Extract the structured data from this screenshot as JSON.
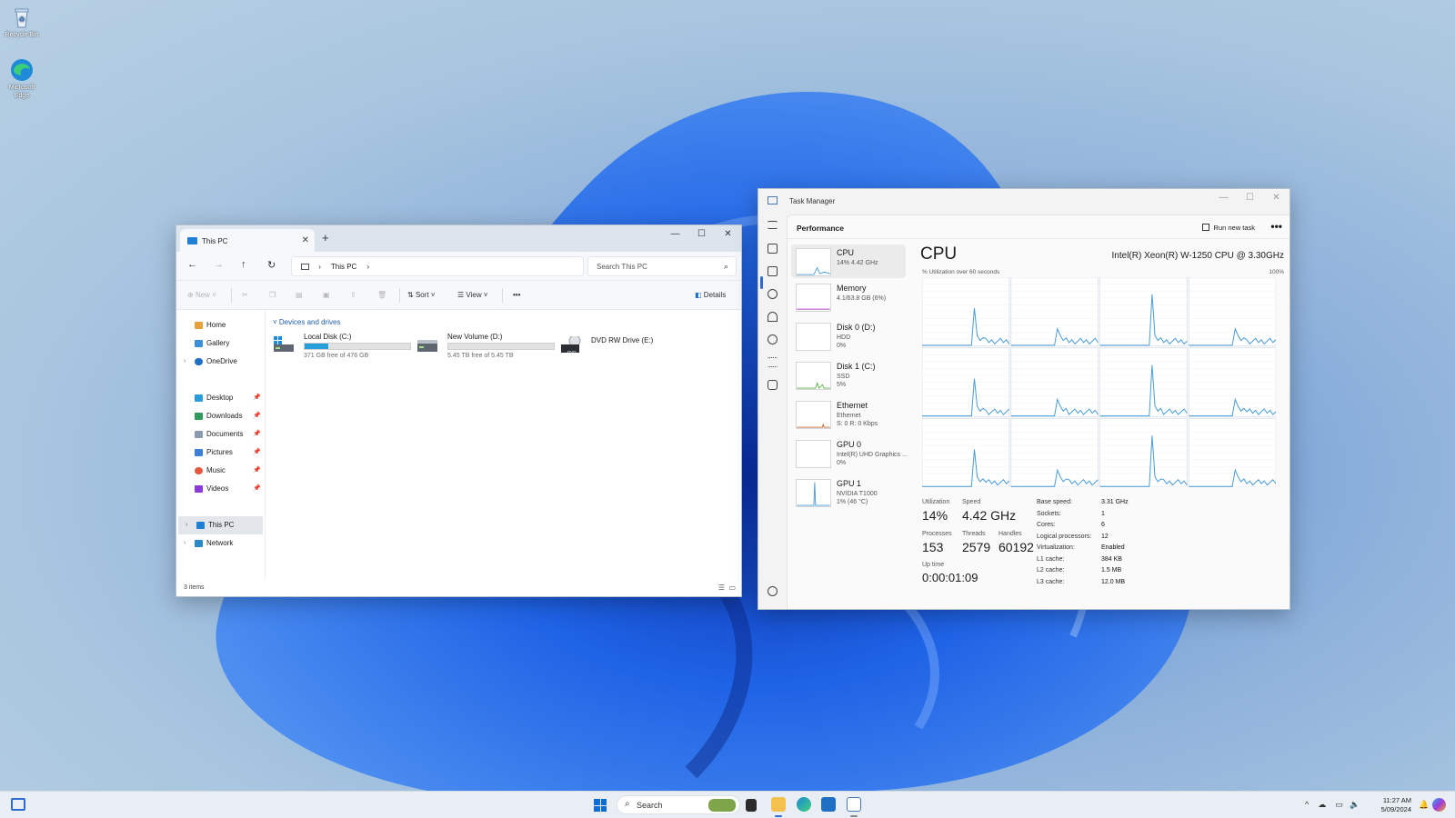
{
  "desktop": {
    "icons": [
      {
        "label": "Recycle Bin",
        "icon": "recycle-bin-icon"
      },
      {
        "label": "Microsoft Edge",
        "icon": "edge-icon"
      }
    ]
  },
  "explorer": {
    "tab_title": "This PC",
    "new_tab_symbol": "+",
    "controls": {
      "minimize": "—",
      "maximize": "☐",
      "close": "✕"
    },
    "nav": {
      "back": "←",
      "forward": "→",
      "up": "↑",
      "refresh": "↻"
    },
    "address": {
      "segment": "This PC",
      "separator": "›"
    },
    "search_placeholder": "Search This PC",
    "toolbar": {
      "new": "New",
      "sort": "Sort",
      "view": "View",
      "more": "•••",
      "details": "Details"
    },
    "sidebar": {
      "home": "Home",
      "gallery": "Gallery",
      "onedrive": "OneDrive",
      "desktop": "Desktop",
      "downloads": "Downloads",
      "documents": "Documents",
      "pictures": "Pictures",
      "music": "Music",
      "videos": "Videos",
      "this_pc": "This PC",
      "network": "Network"
    },
    "group_header": "Devices and drives",
    "drives": [
      {
        "name": "Local Disk (C:)",
        "free": "371 GB free of 476 GB",
        "used_fraction": 0.22
      },
      {
        "name": "New Volume (D:)",
        "free": "5.45 TB free of 5.45 TB",
        "used_fraction": 0.0
      },
      {
        "name": "DVD RW Drive (E:)",
        "badge": "DVD"
      }
    ],
    "status": "3 items"
  },
  "taskmgr": {
    "title": "Task Manager",
    "controls": {
      "minimize": "—",
      "maximize": "☐",
      "close": "✕"
    },
    "section": "Performance",
    "run_new_task": "Run new task",
    "more": "•••",
    "resources": [
      {
        "name": "CPU",
        "sub1": "14% 4.42 GHz",
        "sub2": "",
        "sub3": ""
      },
      {
        "name": "Memory",
        "sub1": "4.1/63.8 GB (6%)",
        "sub2": "",
        "sub3": ""
      },
      {
        "name": "Disk 0 (D:)",
        "sub1": "HDD",
        "sub2": "0%",
        "sub3": ""
      },
      {
        "name": "Disk 1 (C:)",
        "sub1": "SSD",
        "sub2": "5%",
        "sub3": ""
      },
      {
        "name": "Ethernet",
        "sub1": "Ethernet",
        "sub2": "S: 0 R: 0 Kbps",
        "sub3": ""
      },
      {
        "name": "GPU 0",
        "sub1": "Intel(R) UHD Graphics ...",
        "sub2": "0%",
        "sub3": ""
      },
      {
        "name": "GPU 1",
        "sub1": "NVIDIA T1000",
        "sub2": "1% (46 °C)",
        "sub3": ""
      }
    ],
    "cpu": {
      "title": "CPU",
      "model": "Intel(R) Xeon(R) W-1250 CPU @ 3.30GHz",
      "util_label": "% Utilization over 60 seconds",
      "util_max": "100%",
      "stats": {
        "utilization_label": "Utilization",
        "utilization": "14%",
        "speed_label": "Speed",
        "speed": "4.42 GHz",
        "processes_label": "Processes",
        "processes": "153",
        "threads_label": "Threads",
        "threads": "2579",
        "handles_label": "Handles",
        "handles": "60192",
        "uptime_label": "Up time",
        "uptime": "0:00:01:09"
      },
      "specs": [
        {
          "label": "Base speed:",
          "value": "3.31 GHz"
        },
        {
          "label": "Sockets:",
          "value": "1"
        },
        {
          "label": "Cores:",
          "value": "6"
        },
        {
          "label": "Logical processors:",
          "value": "12"
        },
        {
          "label": "Virtualization:",
          "value": "Enabled"
        },
        {
          "label": "L1 cache:",
          "value": "384 KB"
        },
        {
          "label": "L2 cache:",
          "value": "1.5 MB"
        },
        {
          "label": "L3 cache:",
          "value": "12.0 MB"
        }
      ]
    }
  },
  "taskbar": {
    "search_placeholder": "Search",
    "time": "11:27 AM",
    "date": "5/09/2024",
    "tray": "^"
  },
  "colors": {
    "accent": "#0f6cd6",
    "graph_line": "#4a9bd6",
    "drive_fill": "#26a0da"
  }
}
